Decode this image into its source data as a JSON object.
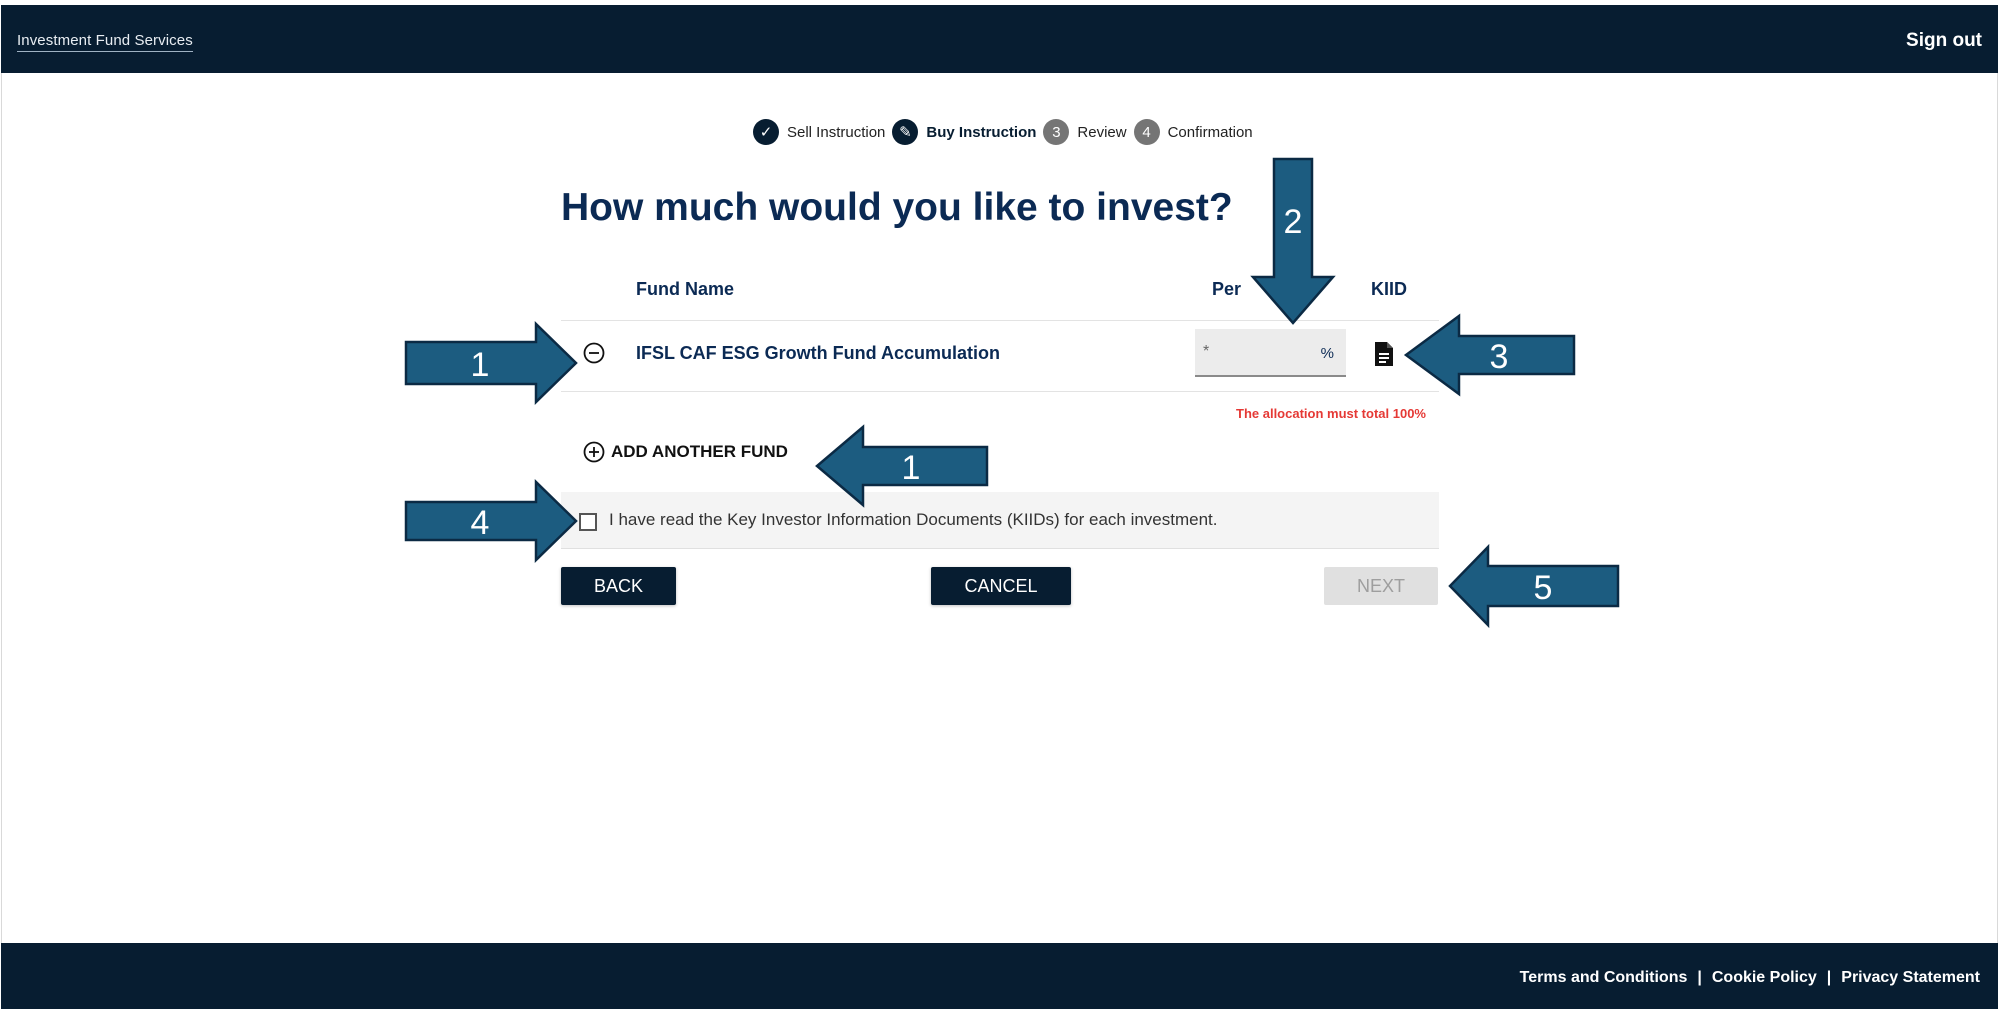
{
  "header": {
    "brand": "Investment Fund Services",
    "signout_label": "Sign out"
  },
  "stepper": {
    "steps": [
      {
        "label": "Sell Instruction",
        "marker": "✓",
        "state": "done"
      },
      {
        "label": "Buy Instruction",
        "marker": "✎",
        "state": "active"
      },
      {
        "label": "Review",
        "marker": "3",
        "state": "todo"
      },
      {
        "label": "Confirmation",
        "marker": "4",
        "state": "todo"
      }
    ]
  },
  "main": {
    "title": "How much would you like to invest?",
    "columns": {
      "fund_name": "Fund Name",
      "percent": "Per",
      "kiid": "KIID"
    },
    "fund_row": {
      "name": "IFSL CAF ESG Growth Fund Accumulation",
      "percent_placeholder": "*",
      "percent_value": "",
      "percent_suffix": "%"
    },
    "error": "The allocation must total 100%",
    "add_fund_label": "ADD ANOTHER FUND",
    "acknowledgement": {
      "text": "I have read the Key Investor Information Documents (KIIDs) for each investment.",
      "checked": false
    },
    "buttons": {
      "back": "BACK",
      "cancel": "CANCEL",
      "next": "NEXT"
    }
  },
  "annotations": {
    "remove_fund": "1",
    "percent_input": "2",
    "kiid_doc": "3",
    "add_fund": "1",
    "acknowledge": "4",
    "next": "5"
  },
  "footer": {
    "links": [
      "Terms and Conditions",
      "Cookie Policy",
      "Privacy Statement"
    ],
    "separator": "|"
  },
  "colors": {
    "navy": "#071d31",
    "title": "#0b2a54",
    "error": "#e53935",
    "arrow_fill": "#1c5c80",
    "arrow_stroke": "#0b2a44"
  },
  "icons": {
    "remove": "minus-circle-icon",
    "add": "plus-circle-icon",
    "kiid": "document-icon",
    "done_step": "check-icon",
    "active_step": "pencil-icon"
  }
}
